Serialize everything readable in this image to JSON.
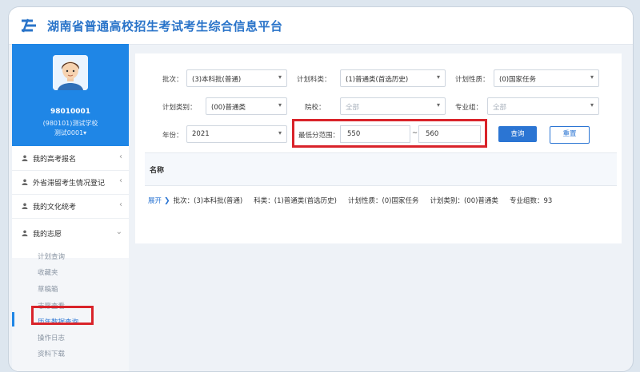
{
  "header": {
    "title": "湖南省普通高校招生考试考生综合信息平台"
  },
  "profile": {
    "id": "98010001",
    "school": "(980101)测试学校",
    "user": "测试0001"
  },
  "sidebar": {
    "items": [
      {
        "label": "我的高考报名",
        "chevron": "‹"
      },
      {
        "label": "外省滞留考生情况登记",
        "chevron": "‹"
      },
      {
        "label": "我的文化统考",
        "chevron": "‹"
      },
      {
        "label": "我的志愿",
        "chevron": "⌄"
      }
    ],
    "subitems": [
      {
        "label": "计划查询"
      },
      {
        "label": "收藏夹"
      },
      {
        "label": "草稿箱"
      },
      {
        "label": "志愿查看"
      },
      {
        "label": "历年数据查询"
      },
      {
        "label": "操作日志"
      },
      {
        "label": "资料下载"
      }
    ],
    "active_subitem": "历年数据查询"
  },
  "filters": {
    "batch": {
      "label": "批次：",
      "value": "(3)本科批(普通)"
    },
    "subject": {
      "label": "计划科类：",
      "value": "(1)普通类(首选历史)"
    },
    "nature": {
      "label": "计划性质：",
      "value": "(0)国家任务"
    },
    "category": {
      "label": "计划类别：",
      "value": "(00)普通类"
    },
    "school": {
      "label": "院校：",
      "placeholder": "全部"
    },
    "major_group": {
      "label": "专业组：",
      "placeholder": "全部"
    },
    "year": {
      "label": "年份：",
      "value": "2021"
    },
    "score_range": {
      "label": "最低分范围：",
      "min": "550",
      "separator": "~",
      "max": "560"
    }
  },
  "buttons": {
    "query": "查询",
    "reset": "重置"
  },
  "table": {
    "header": "名称"
  },
  "summary": {
    "expand": "展开",
    "batch": "批次：(3)本科批(普通)",
    "subject": "科类：(1)普通类(首选历史)",
    "nature": "计划性质：(0)国家任务",
    "category": "计划类别：(00)普通类",
    "count": "专业组数：93"
  },
  "colors": {
    "brand": "#1f86e6",
    "primary_button": "#2b75d3",
    "highlight": "#d9232a"
  }
}
